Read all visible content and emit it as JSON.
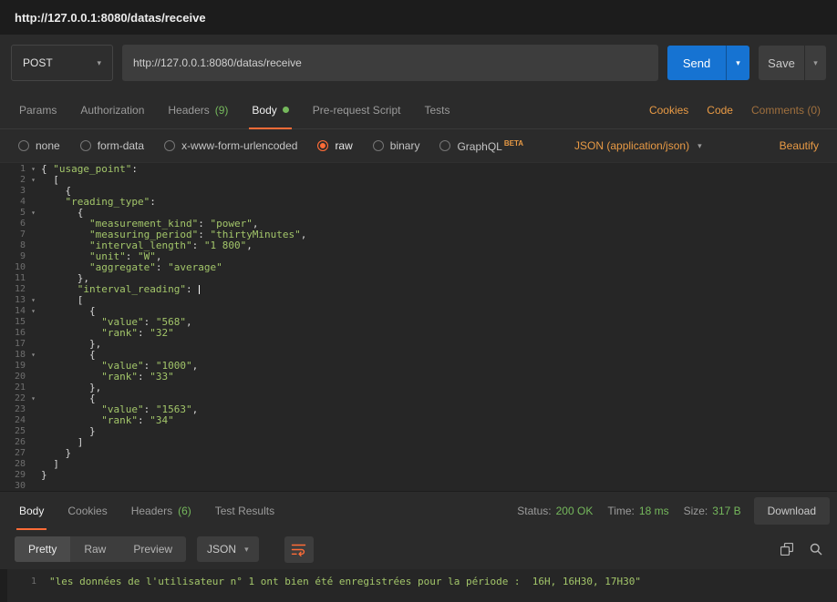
{
  "titlebar": {
    "title": "http://127.0.0.1:8080/datas/receive"
  },
  "request": {
    "method": "POST",
    "url": "http://127.0.0.1:8080/datas/receive",
    "send": "Send",
    "save": "Save"
  },
  "request_tabs": {
    "params": "Params",
    "authorization": "Authorization",
    "headers": "Headers",
    "headers_count": "(9)",
    "body": "Body",
    "pre_request": "Pre-request Script",
    "tests": "Tests",
    "cookies": "Cookies",
    "code": "Code",
    "comments": "Comments (0)"
  },
  "body_bar": {
    "options": [
      {
        "label": "none",
        "selected": false
      },
      {
        "label": "form-data",
        "selected": false
      },
      {
        "label": "x-www-form-urlencoded",
        "selected": false
      },
      {
        "label": "raw",
        "selected": true
      },
      {
        "label": "binary",
        "selected": false
      },
      {
        "label": "GraphQL",
        "selected": false
      }
    ],
    "beta": "BETA",
    "content_type": "JSON (application/json)",
    "beautify": "Beautify"
  },
  "editor": {
    "cursor_line": 12,
    "fold_lines": [
      1,
      2,
      5,
      13,
      14,
      18,
      22
    ],
    "lines": [
      "{ \"usage_point\":",
      "  [",
      "    {",
      "    \"reading_type\":",
      "      {",
      "        \"measurement_kind\": \"power\",",
      "        \"measuring_period\": \"thirtyMinutes\",",
      "        \"interval_length\": \"1 800\",",
      "        \"unit\": \"W\",",
      "        \"aggregate\": \"average\"",
      "      },",
      "      \"interval_reading\": ",
      "      [",
      "        {",
      "          \"value\": \"568\",",
      "          \"rank\": \"32\"",
      "        },",
      "        {",
      "          \"value\": \"1000\",",
      "          \"rank\": \"33\"",
      "        },",
      "        {",
      "          \"value\": \"1563\",",
      "          \"rank\": \"34\"",
      "        }",
      "      ]",
      "    }",
      "  ]",
      "}",
      ""
    ]
  },
  "response": {
    "tabs": {
      "body": "Body",
      "cookies": "Cookies",
      "headers": "Headers",
      "headers_count": "(6)",
      "test_results": "Test Results"
    },
    "status_label": "Status:",
    "status_value": "200 OK",
    "time_label": "Time:",
    "time_value": "18 ms",
    "size_label": "Size:",
    "size_value": "317 B",
    "download": "Download",
    "views": {
      "pretty": "Pretty",
      "raw": "Raw",
      "preview": "Preview"
    },
    "format": "JSON",
    "body_line_number": "1",
    "body_line": "\"les données de l'utilisateur n° 1 ont bien été enregistrées pour la période :  16H, 16H30, 17H30\""
  },
  "colors": {
    "accent_orange": "#ff6c37",
    "link_orange": "#e89a45",
    "green": "#75b85c",
    "send_blue": "#1673d2",
    "string_green": "#a3c66a"
  }
}
